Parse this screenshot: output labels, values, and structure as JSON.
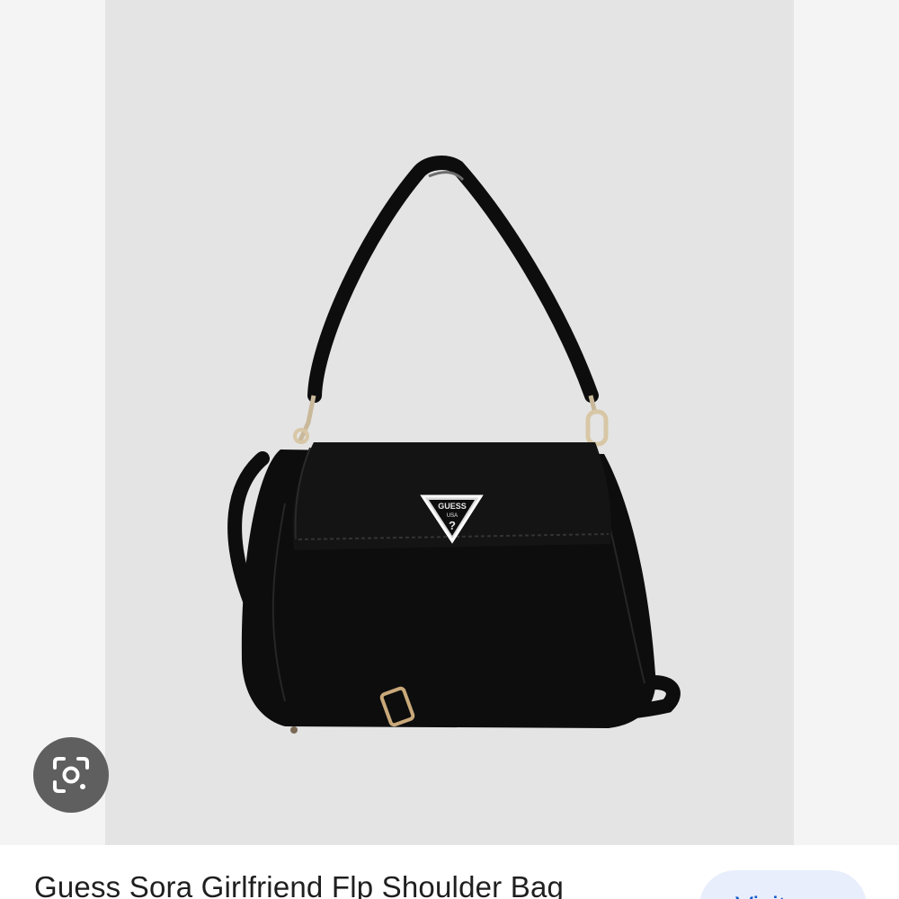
{
  "product": {
    "title": "Guess Sora Girlfriend Flp Shoulder Bag",
    "logo_text": "GUESS",
    "logo_subtext": "USA",
    "logo_mark": "?"
  },
  "actions": {
    "visit_label": "Visit",
    "visit_icon": "chevron-right-icon",
    "lens_icon": "google-lens-icon"
  },
  "colors": {
    "image_background": "#e4e4e4",
    "side_background": "#f4f4f4",
    "bag": "#0d0d0d",
    "lens_button": "#5f5f5f",
    "visit_button_bg": "#e8eefc",
    "visit_button_text": "#0b57d0",
    "title_text": "#1f1f1f"
  }
}
